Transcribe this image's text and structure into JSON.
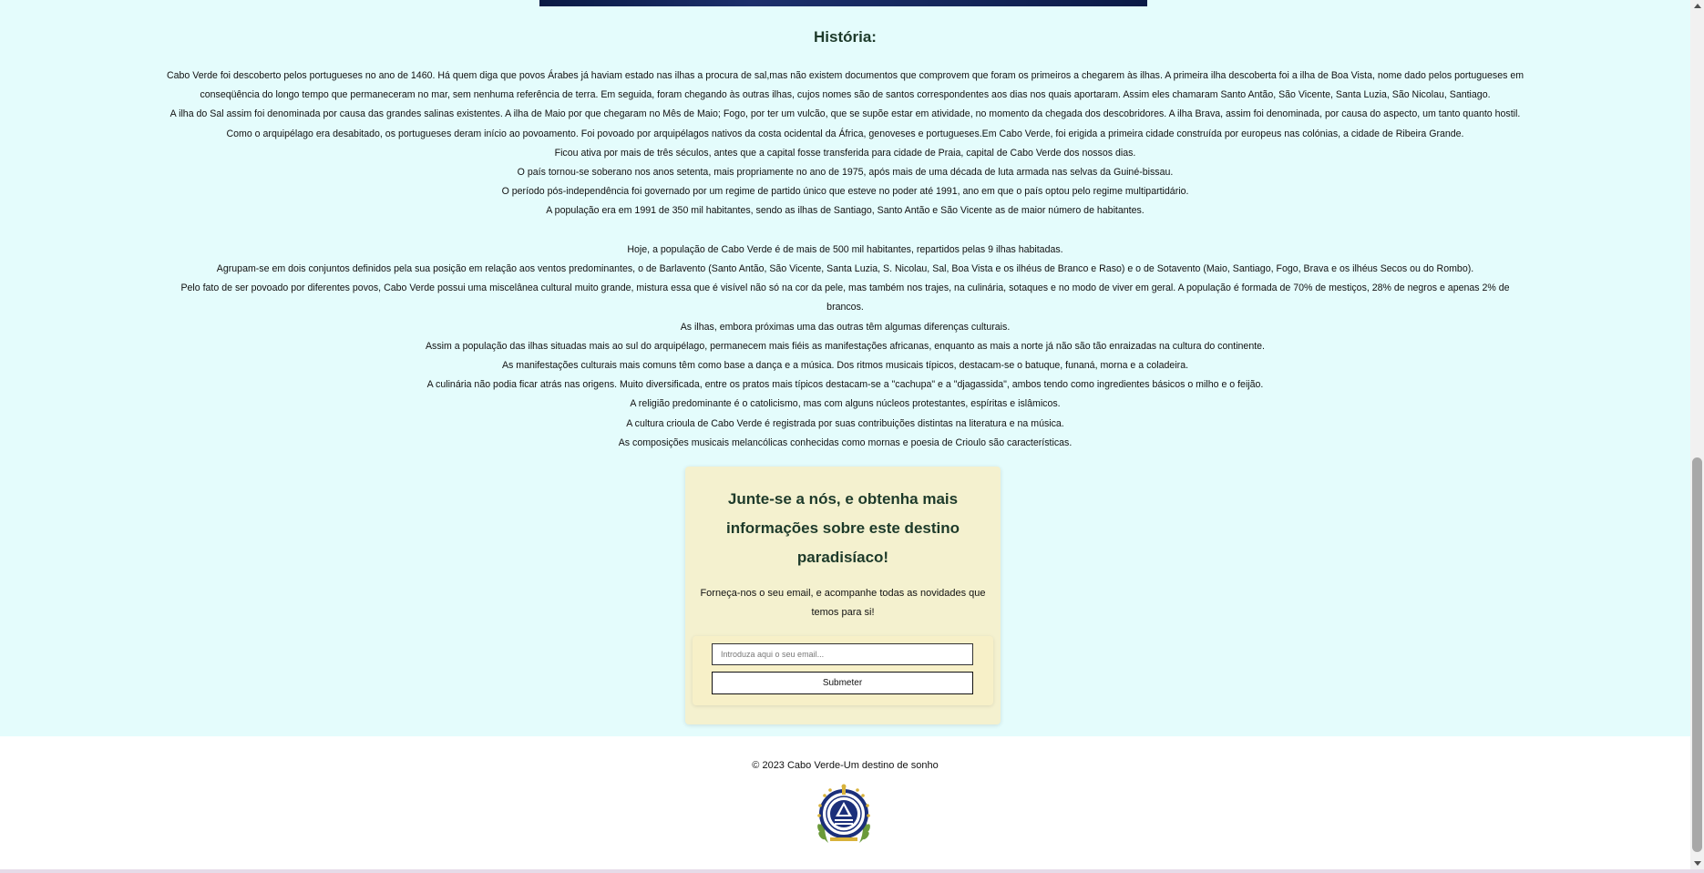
{
  "history": {
    "title": "História:",
    "paragraphs": [
      "Cabo Verde foi descoberto pelos portugueses no ano de 1460. Há quem diga que povos Árabes já haviam estado nas ilhas a procura de sal,mas não existem documentos que comprovem que foram os primeiros a chegarem às ilhas. A primeira ilha descoberta foi a ilha de Boa Vista, nome dado pelos portugueses em conseqüência do longo tempo que permaneceram no mar, sem nenhuma referência de terra. Em seguida, foram chegando às outras ilhas, cujos nomes são de santos correspondentes aos dias nos quais aportaram. Assim eles chamaram Santo Antão, São Vicente, Santa Luzia, São Nicolau, Santiago.",
      "A ilha do Sal assim foi denominada por causa das grandes salinas existentes. A ilha de Maio por que chegaram no Mês de Maio; Fogo, por ter um vulcão, que se supõe estar em atividade, no momento da chegada dos descobridores. A ilha Brava, assim foi denominada, por causa do aspecto, um tanto quanto hostil. Como o arquipélago era desabitado, os portugueses deram início ao povoamento. Foi povoado por arquipélagos nativos da costa ocidental da África, genoveses e portugueses.Em Cabo Verde, foi erigida a primeira cidade construída por europeus nas colónias, a cidade de Ribeira Grande.",
      "Ficou ativa por mais de três séculos, antes que a capital fosse transferida para cidade de Praia, capital de Cabo Verde dos nossos dias.",
      "O país tornou-se soberano nos anos setenta, mais propriamente no ano de 1975, após mais de uma década de luta armada nas selvas da Guiné-bissau.",
      "O período pós-independência foi governado por um regime de partido único que esteve no poder até 1991, ano em que o país optou pelo regime multipartidário.",
      "A população era em 1991 de 350 mil habitantes, sendo as ilhas de Santiago, Santo Antão e São Vicente as de maior número de habitantes.",
      "Hoje, a população de Cabo Verde é de mais de 500 mil habitantes, repartidos pelas 9 ilhas habitadas.",
      "Agrupam-se em dois conjuntos definidos pela sua posição em relação aos ventos predominantes, o de Barlavento (Santo Antão, São Vicente, Santa Luzia, S. Nicolau, Sal, Boa Vista e os ilhéus de Branco e Raso) e o de Sotavento (Maio, Santiago, Fogo, Brava e os ilhéus Secos ou do Rombo).",
      "Pelo fato de ser povoado por diferentes povos, Cabo Verde possui uma miscelânea cultural muito grande, mistura essa que é visível não só na cor da pele, mas também nos trajes, na culinária, sotaques e no modo de viver em geral. A população é formada de 70% de mestiços, 28% de negros e apenas 2% de brancos.",
      "As ilhas, embora próximas uma das outras têm algumas diferenças culturais.",
      "Assim a população das ilhas situadas mais ao sul do arquipélago, permanecem mais fiéis as manifestações africanas, enquanto as mais a norte já não são tão enraizadas na cultura do continente.",
      "As manifestações culturais mais comuns têm como base a dança e a música. Dos ritmos musicais típicos, destacam-se o batuque, funaná, morna e a coladeira.",
      "A culinária não podia ficar atrás nas origens. Muito diversificada, entre os pratos mais típicos destacam-se a \"cachupa\" e a \"djagassida\", ambos tendo como ingredientes básicos o milho e o feijão.",
      "A religião predominante é o catolicismo, mas com alguns núcleos protestantes, espíritas e islâmicos.",
      "A cultura crioula de Cabo Verde é registrada por suas contribuições distintas na literatura e na música.",
      "As composições musicais melancólicas conhecidas como mornas e poesia de Crioulo são características."
    ]
  },
  "newsletter": {
    "heading": "Junte-se a nós, e obtenha mais informações sobre este destino paradisíaco!",
    "text": "Forneça-nos o seu email, e acompanhe todas as novidades que temos para si!",
    "email_placeholder": "Introduza aqui o seu email...",
    "submit_label": "Submeter"
  },
  "footer": {
    "copyright": "© 2023 Cabo Verde-Um destino de sonho",
    "emblem_icon": "cabo-verde-coat-of-arms-icon"
  },
  "colors": {
    "main_background": "#e4fcfc",
    "card_background": "#f4f1cf",
    "heading_color": "#1d3a2a",
    "emblem_blue": "#1b2f7a",
    "emblem_gold": "#d8b23a",
    "emblem_green": "#6b9a3a"
  }
}
